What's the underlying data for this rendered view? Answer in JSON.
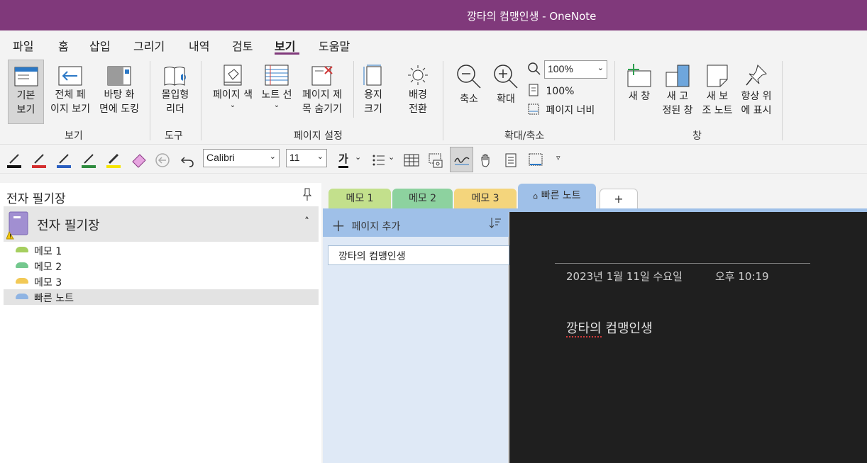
{
  "window": {
    "title": "깡타의 컴맹인생  -  OneNote"
  },
  "menu_tabs": [
    "파일",
    "홈",
    "삽입",
    "그리기",
    "내역",
    "검토",
    "보기",
    "도움말"
  ],
  "active_tab": "보기",
  "ribbon": {
    "views": {
      "normal_line1": "기본",
      "normal_line2": "보기",
      "fullpage_line1": "전체 페",
      "fullpage_line2": "이지 보기",
      "dock_line1": "바탕 화",
      "dock_line2": "면에 도킹",
      "group": "보기"
    },
    "tools": {
      "immersive_line1": "몰입형",
      "immersive_line2": "리더",
      "group": "도구"
    },
    "page_setup": {
      "page_color": "페이지 색",
      "rule_lines": "노트 선",
      "hide_title_line1": "페이지 제",
      "hide_title_line2": "목 숨기기",
      "paper_line1": "용지",
      "paper_line2": "크기",
      "bg_line1": "배경",
      "bg_line2": "전환",
      "group": "페이지 설정"
    },
    "zoom": {
      "zoom_out": "축소",
      "zoom_in": "확대",
      "zoom_value": "100%",
      "hundred": "100%",
      "page_width": "페이지 너비",
      "group": "확대/축소"
    },
    "window": {
      "new_line1": "새 창",
      "docked_line1": "새 고",
      "docked_line2": "정된 창",
      "side_line1": "새 보",
      "side_line2": "조 노트",
      "top_line1": "항상 위",
      "top_line2": "에 표시",
      "group": "창"
    }
  },
  "toolbar": {
    "font": "Calibri",
    "size": "11",
    "bold_glyph": "가"
  },
  "sidebar": {
    "header": "전자 필기장",
    "notebook": "전자 필기장",
    "sections": [
      {
        "label": "메모 1",
        "color": "#a6cf5f"
      },
      {
        "label": "메모 2",
        "color": "#74c88e"
      },
      {
        "label": "메모 3",
        "color": "#f2c956"
      },
      {
        "label": "빠른 노트",
        "color": "#8fb4e3"
      }
    ]
  },
  "section_tabs": [
    {
      "label": "메모 1",
      "color": "#c3e08c"
    },
    {
      "label": "메모 2",
      "color": "#8dd29f"
    },
    {
      "label": "메모 3",
      "color": "#f4d57c"
    },
    {
      "label": "빠른 노트",
      "color": "#9fc0e8"
    },
    {
      "label": "+",
      "color": "#ffffff"
    }
  ],
  "page_list": {
    "add_label": "페이지 추가",
    "pages": [
      "깡타의 컴맹인생"
    ]
  },
  "note": {
    "date": "2023년 1월 11일 수요일",
    "time": "오후 10:19",
    "body": "깡타의 컴맹인생",
    "underlined": "깡타의"
  }
}
